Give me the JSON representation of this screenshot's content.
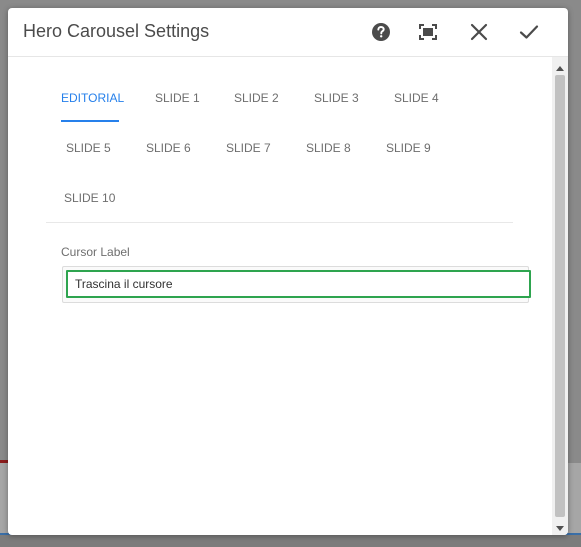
{
  "dialog": {
    "title": "Hero Carousel Settings",
    "icons": {
      "help": "help-icon",
      "fullscreen": "fullscreen-icon",
      "close": "close-icon",
      "confirm": "check-icon"
    }
  },
  "tabs": [
    {
      "label": "EDITORIAL",
      "active": true
    },
    {
      "label": "SLIDE 1",
      "active": false
    },
    {
      "label": "SLIDE 2",
      "active": false
    },
    {
      "label": "SLIDE 3",
      "active": false
    },
    {
      "label": "SLIDE 4",
      "active": false
    },
    {
      "label": "SLIDE 5",
      "active": false
    },
    {
      "label": "SLIDE 6",
      "active": false
    },
    {
      "label": "SLIDE 7",
      "active": false
    },
    {
      "label": "SLIDE 8",
      "active": false
    },
    {
      "label": "SLIDE 9",
      "active": false
    },
    {
      "label": "SLIDE 10",
      "active": false
    }
  ],
  "form": {
    "cursor_label": {
      "label": "Cursor Label",
      "value": "Trascina il cursore"
    }
  },
  "colors": {
    "accent": "#2680eb",
    "focus_ring": "#2ea44f",
    "text": "#4b4b4b"
  }
}
